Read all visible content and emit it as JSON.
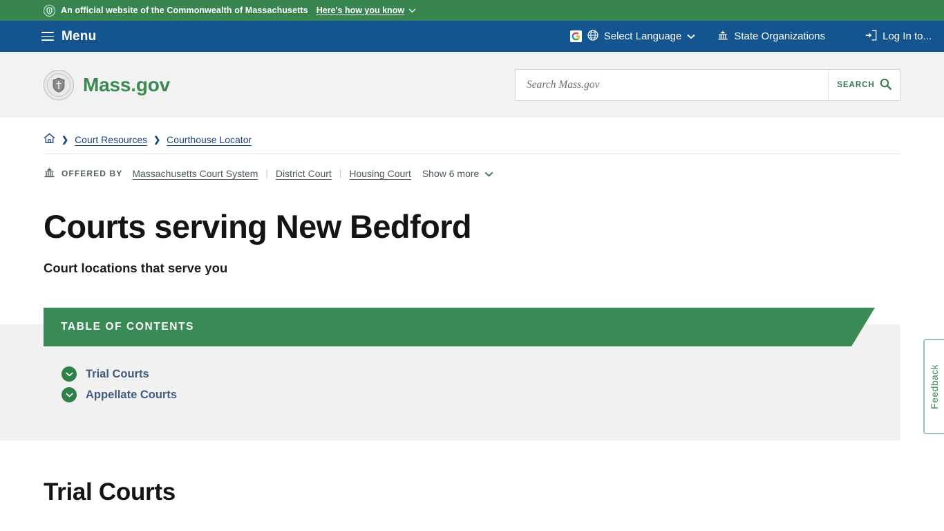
{
  "official_banner": {
    "icon": "shield-badge-icon",
    "text": "An official website of the Commonwealth of Massachusetts",
    "how_you_know_label": "Here's how you know",
    "chevron": "⌄",
    "background_color": "#388550"
  },
  "main_nav": {
    "menu_label": "Menu",
    "menu_icon": "hamburger-icon",
    "background_color": "#14558f",
    "items": [
      {
        "icon": "google-translate-icon",
        "glyph": "G",
        "globe_icon": "🌐",
        "label": "Select Language",
        "chevron": "⌄"
      },
      {
        "icon": "capitol-building-icon",
        "label": "State Organizations"
      },
      {
        "icon": "login-arrow-icon",
        "label": "Log In to..."
      }
    ]
  },
  "brand": {
    "seal_icon": "massachusetts-state-seal-icon",
    "name": "Mass.gov",
    "color": "#3a8a52"
  },
  "search": {
    "placeholder": "Search Mass.gov",
    "value": "",
    "button_label": "SEARCH",
    "button_icon": "magnifier-icon"
  },
  "breadcrumb": {
    "home_icon": "home-icon",
    "separator": "❯",
    "items": [
      {
        "label": "Court Resources"
      },
      {
        "label": "Courthouse Locator"
      }
    ]
  },
  "offered_by": {
    "icon": "capitol-building-icon",
    "label": "OFFERED BY",
    "organizations": [
      {
        "label": "Massachusetts Court System"
      },
      {
        "label": "District Court"
      },
      {
        "label": "Housing Court"
      }
    ],
    "divider": "|",
    "show_more_label": "Show 6 more",
    "show_more_chevron": "⌄"
  },
  "page": {
    "title": "Courts serving New Bedford",
    "subtitle": "Court locations that serve you"
  },
  "table_of_contents": {
    "heading": "TABLE OF CONTENTS",
    "banner_color": "#3a8a56",
    "items": [
      {
        "label": "Trial Courts",
        "icon": "chevron-down-circle-icon"
      },
      {
        "label": "Appellate Courts",
        "icon": "chevron-down-circle-icon"
      }
    ]
  },
  "sections": [
    {
      "heading": "Trial Courts"
    }
  ],
  "feedback": {
    "label": "Feedback",
    "color": "#3a8a56"
  }
}
